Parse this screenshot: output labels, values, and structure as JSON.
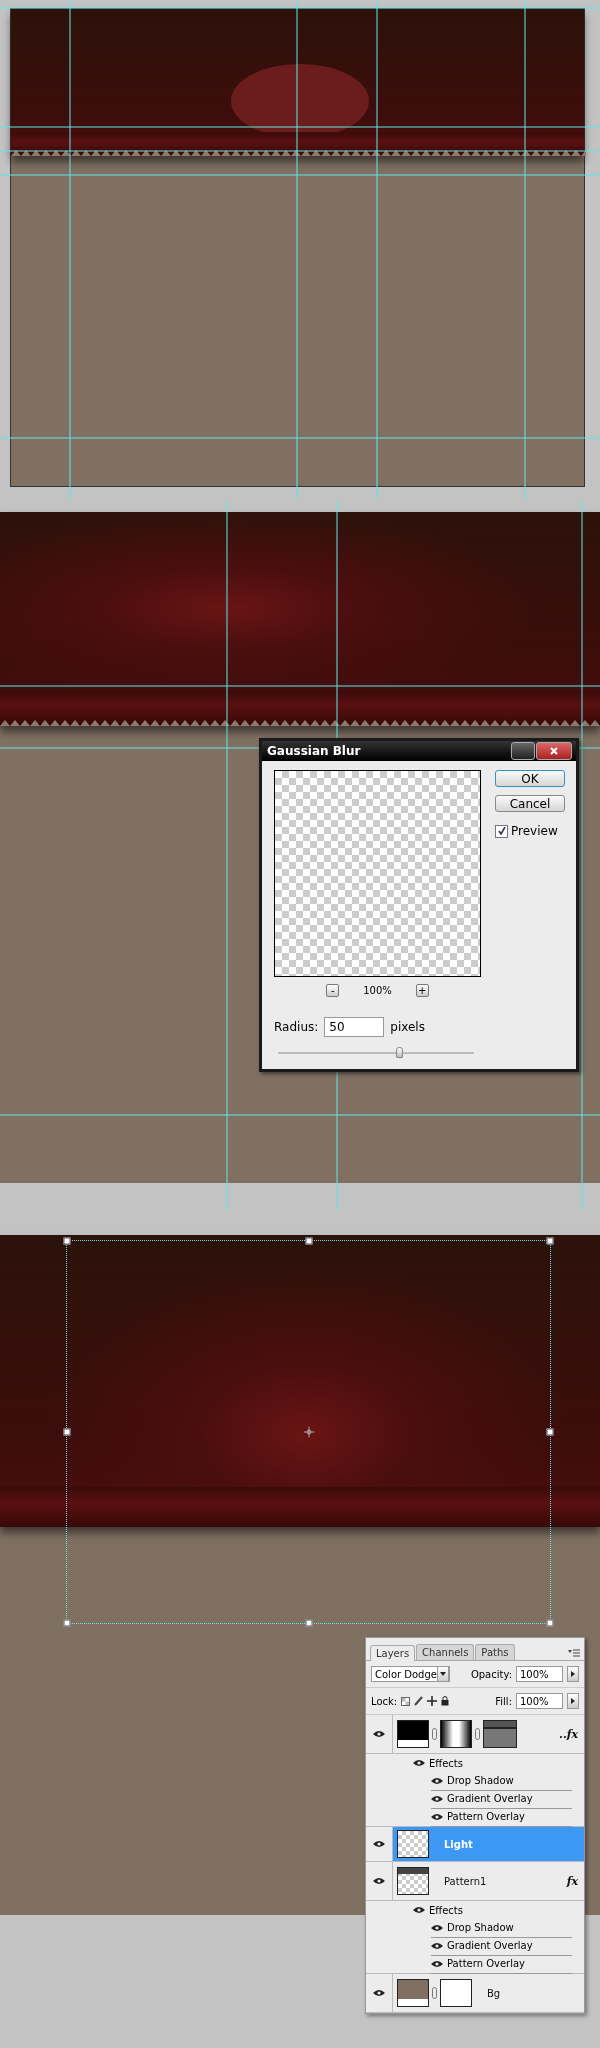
{
  "gaussian_blur": {
    "title": "Gaussian Blur",
    "buttons": [
      "OK",
      "Cancel"
    ],
    "preview": {
      "label": "Preview",
      "checked": true
    },
    "zoom_out": "-",
    "zoom_level": "100%",
    "zoom_in": "+",
    "radius": {
      "label": "Radius:",
      "value": "50",
      "unit": "pixels",
      "level": 0.62
    }
  },
  "layers_panel": {
    "tabs": [
      {
        "label": "Layers",
        "selected": true
      },
      {
        "label": "Channels",
        "selected": false
      },
      {
        "label": "Paths",
        "selected": false
      }
    ],
    "blend_mode": "Color Dodge",
    "opacity": {
      "label": "Opacity:",
      "value": "100%"
    },
    "lock_label": "Lock:",
    "fill": {
      "label": "Fill:",
      "value": "100%"
    },
    "layers": [
      {
        "kind": "adjustment",
        "badge": "..fx",
        "selected": false,
        "effects_label": "Effects",
        "effects": [
          "Drop Shadow",
          "Gradient Overlay",
          "Pattern Overlay"
        ]
      },
      {
        "kind": "transparent",
        "name": "Light",
        "selected": true
      },
      {
        "kind": "pattern",
        "name": "Pattern1",
        "badge": "fx",
        "selected": false,
        "effects_label": "Effects",
        "effects": [
          "Drop Shadow",
          "Gradient Overlay",
          "Pattern Overlay"
        ]
      },
      {
        "kind": "fill",
        "name": "Bg",
        "selected": false
      }
    ]
  }
}
